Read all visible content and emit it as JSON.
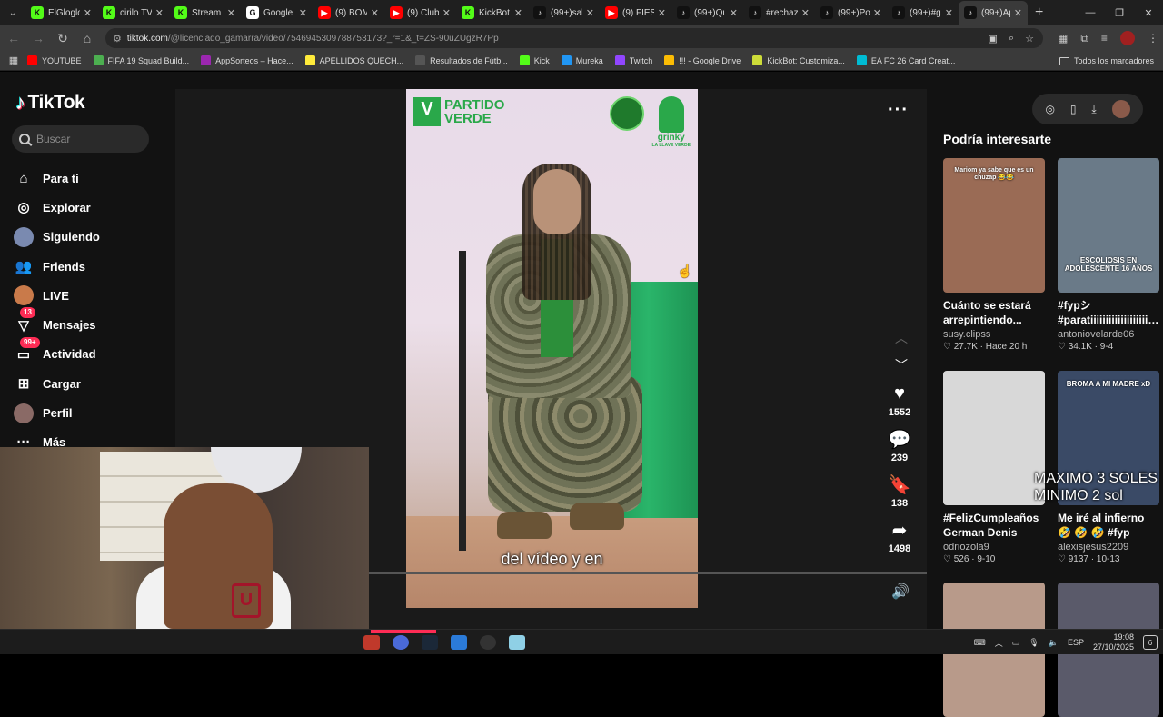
{
  "browser": {
    "tabs": [
      {
        "label": "ElGlogloi",
        "fav_color": "#53fc18",
        "fav_char": "K"
      },
      {
        "label": "cirilo TV",
        "fav_color": "#53fc18",
        "fav_char": "K"
      },
      {
        "label": "Stream",
        "fav_color": "#53fc18",
        "fav_char": "K"
      },
      {
        "label": "Google",
        "fav_color": "#ffffff",
        "fav_char": "G"
      },
      {
        "label": "(9) BOM",
        "fav_color": "#ff0000",
        "fav_char": "▶"
      },
      {
        "label": "(9) Club",
        "fav_color": "#ff0000",
        "fav_char": "▶"
      },
      {
        "label": "KickBot",
        "fav_color": "#53fc18",
        "fav_char": "K"
      },
      {
        "label": "(99+)sal",
        "fav_color": "#111111",
        "fav_char": "♪"
      },
      {
        "label": "(9) FIEST",
        "fav_color": "#ff0000",
        "fav_char": "▶"
      },
      {
        "label": "(99+)Qu",
        "fav_color": "#111111",
        "fav_char": "♪"
      },
      {
        "label": "#rechaz",
        "fav_color": "#111111",
        "fav_char": "♪"
      },
      {
        "label": "(99+)Po",
        "fav_color": "#111111",
        "fav_char": "♪"
      },
      {
        "label": "(99+)#g",
        "fav_color": "#111111",
        "fav_char": "♪"
      },
      {
        "label": "(99+)Ap",
        "fav_color": "#111111",
        "fav_char": "♪",
        "active": true
      }
    ],
    "new_tab": "+",
    "url_host": "tiktok.com",
    "url_path": "/@licenciado_gamarra/video/7546945309788753173?_r=1&_t=ZS-90uZUgzR7Pp",
    "bookmarks": [
      {
        "label": "YOUTUBE",
        "color": "#ff0000"
      },
      {
        "label": "FIFA 19 Squad Build...",
        "color": "#4caf50"
      },
      {
        "label": "AppSorteos – Hace...",
        "color": "#9c27b0"
      },
      {
        "label": "APELLIDOS QUECH...",
        "color": "#ffeb3b"
      },
      {
        "label": "Resultados de Fútb...",
        "color": "#555555"
      },
      {
        "label": "Kick",
        "color": "#53fc18"
      },
      {
        "label": "Mureka",
        "color": "#2196f3"
      },
      {
        "label": "Twitch",
        "color": "#9146ff"
      },
      {
        "label": "!!! - Google Drive",
        "color": "#fbbc04"
      },
      {
        "label": "KickBot: Customiza...",
        "color": "#cddc39"
      },
      {
        "label": "EA FC 26 Card Creat...",
        "color": "#00bcd4"
      }
    ],
    "all_bookmarks": "Todos los marcadores"
  },
  "tiktok": {
    "logo": "TikTok",
    "search_placeholder": "Buscar",
    "nav": [
      {
        "label": "Para ti",
        "icon": "home-icon",
        "glyph": "⌂"
      },
      {
        "label": "Explorar",
        "icon": "compass-icon",
        "glyph": "◎"
      },
      {
        "label": "Siguiendo",
        "icon": "following-avatar",
        "glyph": ""
      },
      {
        "label": "Friends",
        "icon": "friends-icon",
        "glyph": "👥"
      },
      {
        "label": "LIVE",
        "icon": "live-avatar",
        "glyph": ""
      },
      {
        "label": "Mensajes",
        "icon": "messages-icon",
        "glyph": "▽",
        "badge": "13"
      },
      {
        "label": "Actividad",
        "icon": "activity-icon",
        "glyph": "▭",
        "badge": "99+"
      },
      {
        "label": "Cargar",
        "icon": "upload-icon",
        "glyph": "⊞"
      },
      {
        "label": "Perfil",
        "icon": "profile-avatar",
        "glyph": ""
      },
      {
        "label": "Más",
        "icon": "more-icon",
        "glyph": "···"
      }
    ],
    "video": {
      "party_letter": "V",
      "party_line1": "PARTIDO",
      "party_line2": "VERDE",
      "verde_tag": "VERDE",
      "grinky": "grinky",
      "grinky_sub": "LA LLAVE VERDE",
      "subtitle": "del vídeo y en"
    },
    "actions": [
      {
        "name": "like",
        "glyph": "♥",
        "count": "1552"
      },
      {
        "name": "comment",
        "glyph": "💬",
        "count": "239"
      },
      {
        "name": "save",
        "glyph": "🔖",
        "count": "138"
      },
      {
        "name": "share",
        "glyph": "➦",
        "count": "1498"
      }
    ],
    "more_label": "···",
    "recommend_title": "Podría interesarte",
    "cards": [
      {
        "title": "Cuánto se estará arrepintiendo...",
        "user": "susy.clipss",
        "meta": "♡ 27.7K · Hace 20 h",
        "thumb_text": "Mariom ya sabe que es un chuzap 😂😂",
        "color": "#9a6b55"
      },
      {
        "title": "#fypシ #paratiiiiiiiiiiiiiiiiiiii...",
        "user": "antoniovelarde06",
        "meta": "♡ 34.1K · 9-4",
        "thumb_text": "ESCOLIOSIS EN ADOLESCENTE 16 AÑOS",
        "color": "#6a7a88"
      },
      {
        "title": "#FelizCumpleaños German Denis Jugó...",
        "user": "odriozola9",
        "meta": "♡ 526 · 9-10",
        "thumb_text": "",
        "color": "#d8d8d8"
      },
      {
        "title": "Me iré al infierno 🤣 🤣 🤣 #fyp #prank...",
        "user": "alexisjesus2209",
        "meta": "♡ 9137 · 10-13",
        "thumb_text": "BROMA A MI MADRE xD",
        "color": "#3a4a66"
      },
      {
        "title": "",
        "user": "",
        "meta": "",
        "thumb_text": "",
        "color": "#b89a8a"
      },
      {
        "title": "",
        "user": "",
        "meta": "",
        "thumb_text": "",
        "color": "#5a5a6a"
      }
    ],
    "overlay_price_1": "MAXIMO 3 SOLES",
    "overlay_price_2": "MINIMO 2 sol"
  },
  "taskbar": {
    "lang": "ESP",
    "time": "19:08",
    "date": "27/10/2025",
    "notif": "6"
  }
}
